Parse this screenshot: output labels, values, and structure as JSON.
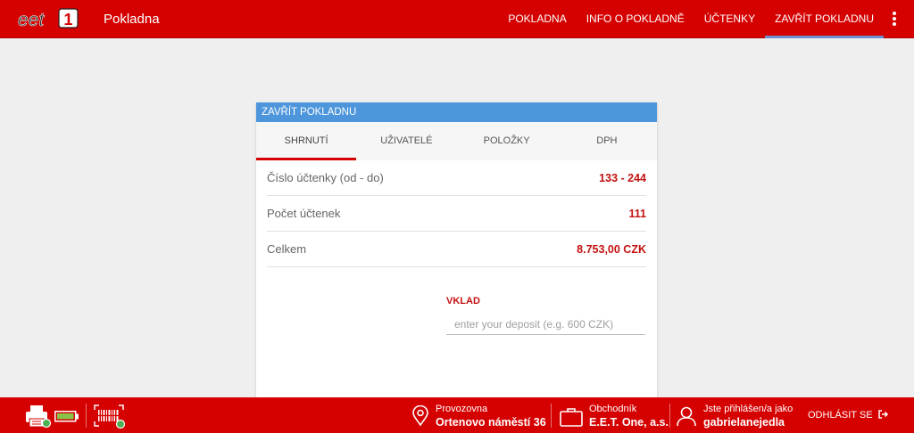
{
  "header": {
    "logo_text": "eet1",
    "app_title": "Pokladna",
    "nav": [
      "POKLADNA",
      "INFO O POKLADNĚ",
      "ÚČTENKY",
      "ZAVŘÍT POKLADNU"
    ],
    "active_nav": "ZAVŘÍT POKLADNU"
  },
  "card": {
    "title": "ZAVŘÍT POKLADNU",
    "tabs": [
      "SHRNUTÍ",
      "UŽIVATELÉ",
      "POLOŽKY",
      "DPH"
    ],
    "active_tab": "SHRNUTÍ",
    "rows": [
      {
        "label": "Číslo účtenky (od - do)",
        "value": "133 - 244"
      },
      {
        "label": "Počet účtenek",
        "value": "111"
      },
      {
        "label": "Celkem",
        "value": "8.753,00 CZK"
      }
    ],
    "deposit": {
      "label": "VKLAD",
      "value": "",
      "placeholder": "enter your deposit (e.g. 600 CZK)"
    }
  },
  "footer": {
    "provozovna_label": "Provozovna",
    "provozovna_value": "Ortenovo náměstí 36",
    "obchodnik_label": "Obchodník",
    "obchodnik_value": "E.E.T. One, a.s.",
    "user_label": "Jste přihlášen/a jako",
    "user_value": "gabrielanejedla",
    "logout_label": "ODHLÁSIT SE",
    "status_ok_color": "#4caf50",
    "battery_color": "#8bc34a"
  },
  "colors": {
    "brand_red": "#d50000",
    "card_header_blue": "#4d96dc",
    "value_red": "#c41010"
  }
}
